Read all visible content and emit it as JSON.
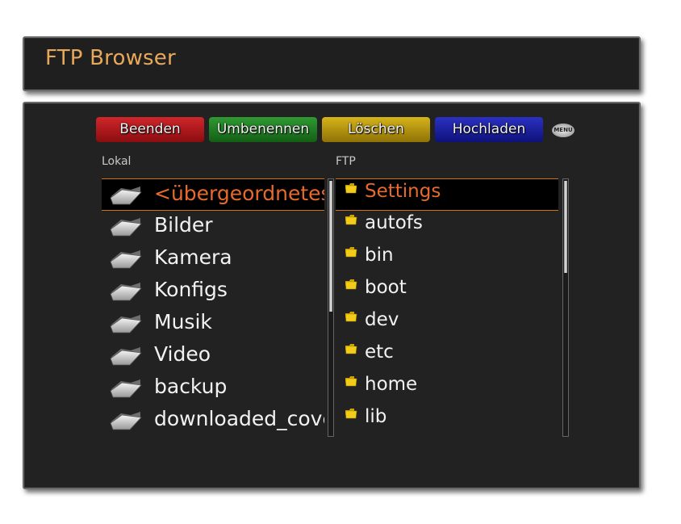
{
  "header": {
    "title": "FTP Browser"
  },
  "buttons": {
    "red": "Beenden",
    "green": "Umbenennen",
    "yellow": "Löschen",
    "blue": "Hochladen",
    "menu": "MENU"
  },
  "local": {
    "label": "Lokal",
    "items": [
      {
        "name": "<übergeordnetes Verzeichnis>",
        "icon": "folder-icon"
      },
      {
        "name": "Bilder",
        "icon": "folder-icon"
      },
      {
        "name": "Kamera",
        "icon": "folder-icon"
      },
      {
        "name": "Konfigs",
        "icon": "folder-icon"
      },
      {
        "name": "Musik",
        "icon": "folder-icon"
      },
      {
        "name": "Video",
        "icon": "folder-icon"
      },
      {
        "name": "backup",
        "icon": "folder-icon"
      },
      {
        "name": "downloaded_covers",
        "icon": "folder-icon"
      }
    ],
    "selected_index": 0
  },
  "ftp": {
    "label": "FTP",
    "items": [
      {
        "name": "Settings",
        "icon": "folder-icon"
      },
      {
        "name": "autofs",
        "icon": "folder-icon"
      },
      {
        "name": "bin",
        "icon": "folder-icon"
      },
      {
        "name": "boot",
        "icon": "folder-icon"
      },
      {
        "name": "dev",
        "icon": "folder-icon"
      },
      {
        "name": "etc",
        "icon": "folder-icon"
      },
      {
        "name": "home",
        "icon": "folder-icon"
      },
      {
        "name": "lib",
        "icon": "folder-icon"
      }
    ],
    "selected_index": 0
  },
  "colors": {
    "title": "#e8a85a",
    "selected_text": "#e66a2c",
    "selection_border": "#d0731f",
    "panel_bg": "#222222",
    "button_red": "#c0181c",
    "button_green": "#238526",
    "button_yellow": "#c4a212",
    "button_blue": "#1c22a8"
  }
}
